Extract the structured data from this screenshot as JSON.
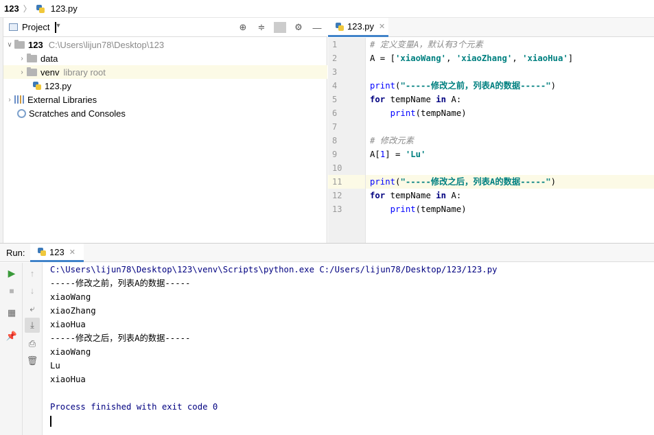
{
  "breadcrumb": {
    "root": "123",
    "file": "123.py"
  },
  "project": {
    "title": "Project",
    "tree": [
      {
        "name": "123",
        "hint": "C:\\Users\\lijun78\\Desktop\\123"
      },
      {
        "name": "data",
        "hint": ""
      },
      {
        "name": "venv",
        "hint": "library root"
      },
      {
        "name": "123.py",
        "hint": ""
      },
      {
        "name": "External Libraries",
        "hint": ""
      },
      {
        "name": "Scratches and Consoles",
        "hint": ""
      }
    ]
  },
  "editor": {
    "tab": "123.py",
    "line_numbers": [
      "1",
      "2",
      "3",
      "4",
      "5",
      "6",
      "7",
      "8",
      "9",
      "10",
      "11",
      "12",
      "13"
    ],
    "highlight_line": 11,
    "code": {
      "l1_comment": "# 定义变量A，默认有3个元素",
      "l2_a": "A = [",
      "l2_s1": "'xiaoWang'",
      "l2_c1": ", ",
      "l2_s2": "'xiaoZhang'",
      "l2_c2": ", ",
      "l2_s3": "'xiaoHua'",
      "l2_end": "]",
      "l4_fn": "print",
      "l4_open": "(",
      "l4_str": "\"-----修改之前，列表A的数据-----\"",
      "l4_close": ")",
      "for_kw": "for",
      "for_var": " tempName ",
      "in_kw": "in",
      "for_tail": " A:",
      "body_indent": "    ",
      "body_fn": "print",
      "body_args": "(tempName)",
      "l8_comment": "# 修改元素",
      "l9_a": "A[",
      "l9_num": "1",
      "l9_b": "] = ",
      "l9_str": "'Lu'",
      "l11_str": "\"-----修改之后，列表A的数据-----\""
    }
  },
  "run": {
    "label": "Run:",
    "tab": "123",
    "output": [
      "C:\\Users\\lijun78\\Desktop\\123\\venv\\Scripts\\python.exe C:/Users/lijun78/Desktop/123/123.py",
      "-----修改之前，列表A的数据-----",
      "xiaoWang",
      "xiaoZhang",
      "xiaoHua",
      "-----修改之后，列表A的数据-----",
      "xiaoWang",
      "Lu",
      "xiaoHua",
      "",
      "Process finished with exit code 0"
    ]
  }
}
